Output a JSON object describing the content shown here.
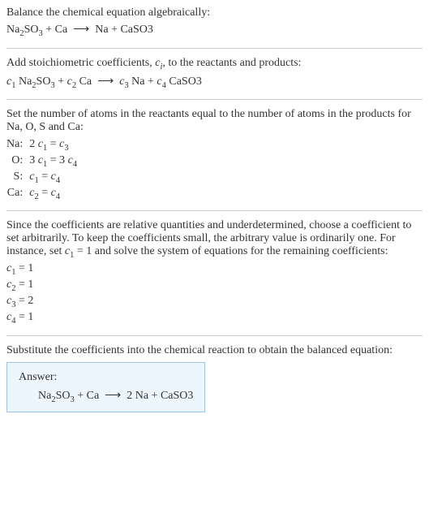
{
  "section1": {
    "prompt": "Balance the chemical equation algebraically:",
    "equation_html": "Na<sub>2</sub>SO<sub>3</sub> + Ca &nbsp;⟶&nbsp; Na + CaSO3"
  },
  "section2": {
    "prompt_html": "Add stoichiometric coefficients, <span class='ital'>c<sub>i</sub></span>, to the reactants and products:",
    "equation_html": "<span class='ital'>c</span><sub>1</sub> Na<sub>2</sub>SO<sub>3</sub> + <span class='ital'>c</span><sub>2</sub> Ca &nbsp;⟶&nbsp; <span class='ital'>c</span><sub>3</sub> Na + <span class='ital'>c</span><sub>4</sub> CaSO3"
  },
  "section3": {
    "prompt": "Set the number of atoms in the reactants equal to the number of atoms in the products for Na, O, S and Ca:",
    "rows": [
      {
        "label": "Na:",
        "eq_html": "2 <span class='ital'>c</span><sub>1</sub> = <span class='ital'>c</span><sub>3</sub>"
      },
      {
        "label": "O:",
        "eq_html": "3 <span class='ital'>c</span><sub>1</sub> = 3 <span class='ital'>c</span><sub>4</sub>"
      },
      {
        "label": "S:",
        "eq_html": "<span class='ital'>c</span><sub>1</sub> = <span class='ital'>c</span><sub>4</sub>"
      },
      {
        "label": "Ca:",
        "eq_html": "<span class='ital'>c</span><sub>2</sub> = <span class='ital'>c</span><sub>4</sub>"
      }
    ]
  },
  "section4": {
    "prompt_html": "Since the coefficients are relative quantities and underdetermined, choose a coefficient to set arbitrarily. To keep the coefficients small, the arbitrary value is ordinarily one. For instance, set <span class='ital'>c</span><sub>1</sub> = 1 and solve the system of equations for the remaining coefficients:",
    "lines_html": [
      "<span class='ital'>c</span><sub>1</sub> = 1",
      "<span class='ital'>c</span><sub>2</sub> = 1",
      "<span class='ital'>c</span><sub>3</sub> = 2",
      "<span class='ital'>c</span><sub>4</sub> = 1"
    ]
  },
  "section5": {
    "prompt": "Substitute the coefficients into the chemical reaction to obtain the balanced equation:",
    "answer_title": "Answer:",
    "answer_eq_html": "Na<sub>2</sub>SO<sub>3</sub> + Ca &nbsp;⟶&nbsp; 2 Na + CaSO3"
  }
}
